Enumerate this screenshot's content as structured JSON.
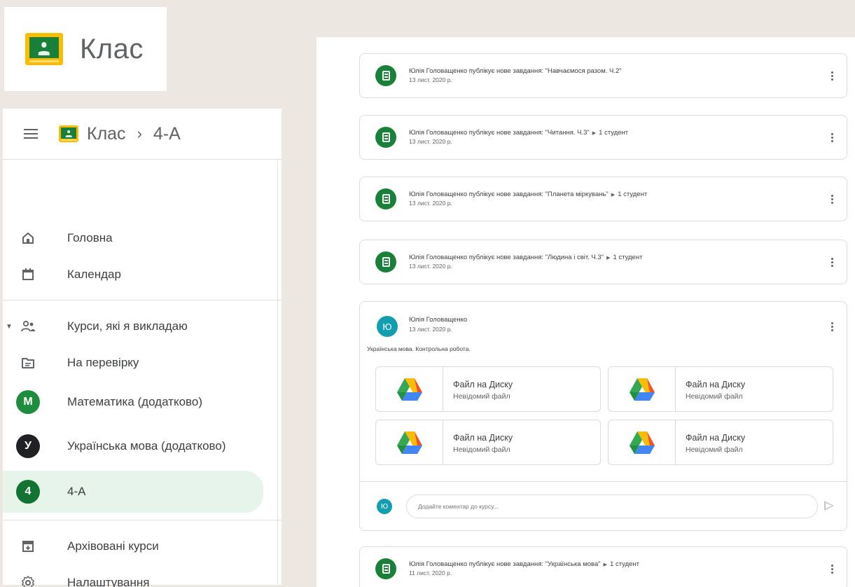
{
  "logo": {
    "title": "Клас"
  },
  "topbar": {
    "app": "Клас",
    "separator": "›",
    "course": "4-А"
  },
  "nav": {
    "home": "Головна",
    "calendar": "Календар",
    "teaching": "Курси, які я викладаю",
    "to_review": "На перевірку",
    "courses": [
      {
        "initial": "М",
        "name": "Математика (додатково)",
        "color": "#1e8e3e"
      },
      {
        "initial": "У",
        "name": "Українська мова (додатково)",
        "color": "#202124"
      },
      {
        "initial": "4",
        "name": "4-А",
        "color": "#137333"
      }
    ],
    "archived": "Архівовані курси",
    "settings": "Налаштування"
  },
  "feed": {
    "posts": [
      {
        "title": "Юлія Головащенко публікує нове завдання: \"Навчаємося разом. Ч.2\"",
        "date": "13 лист. 2020 р.",
        "target": ""
      },
      {
        "title": "Юлія Головащенко публікує нове завдання: \"Читання. Ч.3\"",
        "date": "13 лист. 2020 р.",
        "target": "1 студент"
      },
      {
        "title": "Юлія Головащенко публікує нове завдання: \"Планета міркувань\"",
        "date": "13 лист. 2020 р.",
        "target": "1 студент"
      },
      {
        "title": "Юлія Головащенко публікує нове завдання: \"Людина і світ. Ч.3\"",
        "date": "13 лист. 2020 р.",
        "target": "1 студент"
      }
    ],
    "announcement": {
      "avatar": "Ю",
      "author": "Юлія Головащенко",
      "date": "13 лист. 2020 р.",
      "text": "Українська мова. Контрольна робота.",
      "attachments": [
        {
          "title": "Файл на Диску",
          "sub": "Невідомий файл"
        },
        {
          "title": "Файл на Диску",
          "sub": "Невідомий файл"
        },
        {
          "title": "Файл на Диску",
          "sub": "Невідомий файл"
        },
        {
          "title": "Файл на Диску",
          "sub": "Невідомий файл"
        }
      ],
      "comment_avatar": "Ю",
      "comment_placeholder": "Додайте коментар до курсу..."
    },
    "last_post": {
      "title": "Юлія Головащенко публікує нове завдання: \"Українська мова\"",
      "date": "11 лист. 2020 р.",
      "target": "1 студент"
    }
  },
  "colors": {
    "accent_green": "#188038",
    "avatar_teal": "#129eaf",
    "active_bg": "#e6f4ea"
  }
}
